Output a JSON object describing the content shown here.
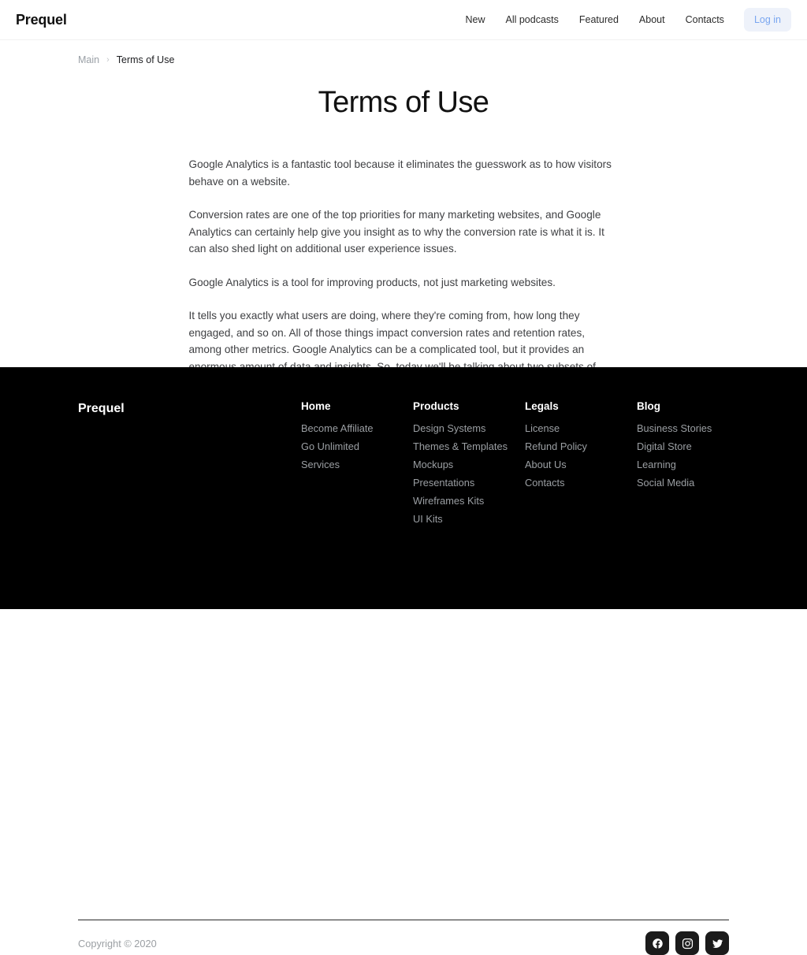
{
  "header": {
    "brand": "Prequel",
    "nav": [
      {
        "label": "New",
        "name": "nav-item-new"
      },
      {
        "label": "All podcasts",
        "name": "nav-item-all-podcasts"
      },
      {
        "label": "Featured",
        "name": "nav-item-featured"
      },
      {
        "label": "About",
        "name": "nav-item-about"
      },
      {
        "label": "Contacts",
        "name": "nav-item-contacts"
      }
    ],
    "login_label": "Log in",
    "login_bg": "#eef2fa",
    "login_color": "#79a6f0"
  },
  "breadcrumb": {
    "root": "Main",
    "separator": "›",
    "current": "Terms of Use"
  },
  "main": {
    "title": "Terms of Use",
    "paragraphs": [
      "Google Analytics is a fantastic tool because it eliminates the guesswork as to how visitors behave on a website.",
      "Conversion rates are one of the top priorities for many marketing websites, and Google Analytics can certainly help give you insight as to why the conversion rate is what it is. It can also shed light on additional user experience issues.",
      "Google Analytics is a tool for improving products, not just marketing websites.",
      "It tells you exactly what users are doing, where they're coming from, how long they engaged, and so on. All of those things impact conversion rates and retention rates, among other metrics. Google Analytics can be a complicated tool, but it provides an enormous amount of data and insights. So, today we'll be talking about two subsets of what you can use Google Analytics for as a UX designer: user behavior and user intent."
    ]
  },
  "footer": {
    "brand": "Prequel",
    "background": "#000000",
    "link_color": "#9b9fa3",
    "columns": [
      {
        "heading": "Home",
        "name": "footer-column-home",
        "links": [
          "Become Affiliate",
          "Go Unlimited",
          "Services"
        ]
      },
      {
        "heading": "Products",
        "name": "footer-column-products",
        "links": [
          "Design Systems",
          "Themes & Templates",
          "Mockups",
          "Presentations",
          "Wireframes Kits",
          "UI Kits"
        ]
      },
      {
        "heading": "Legals",
        "name": "footer-column-legals",
        "links": [
          "License",
          "Refund Policy",
          "About Us",
          "Contacts"
        ]
      },
      {
        "heading": "Blog",
        "name": "footer-column-blog",
        "links": [
          "Business Stories",
          "Digital Store",
          "Learning",
          "Social Media"
        ]
      }
    ],
    "copyright": "Copyright © 2020",
    "socials": [
      {
        "name": "facebook-icon",
        "label": "Facebook"
      },
      {
        "name": "instagram-icon",
        "label": "Instagram"
      },
      {
        "name": "twitter-icon",
        "label": "Twitter"
      }
    ]
  }
}
